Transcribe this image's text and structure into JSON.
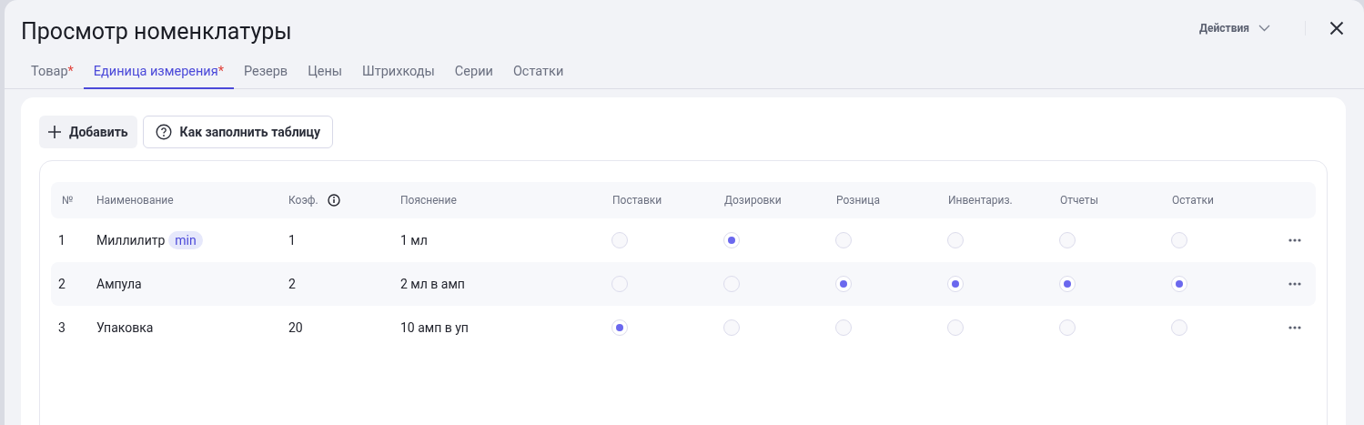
{
  "title": "Просмотр номенклатуры",
  "actions": {
    "label": "Действия"
  },
  "tabs": [
    {
      "label": "Товар",
      "mark": "*",
      "selected": false
    },
    {
      "label": "Единица измерения",
      "mark": "*",
      "selected": true
    },
    {
      "label": "Резерв",
      "selected": false
    },
    {
      "label": "Цены",
      "selected": false
    },
    {
      "label": "Штрихкоды",
      "selected": false
    },
    {
      "label": "Серии",
      "selected": false
    },
    {
      "label": "Остатки",
      "selected": false
    }
  ],
  "toolbar": {
    "add": "Добавить",
    "help": "Как заполнить таблицу"
  },
  "table": {
    "columns": [
      "№",
      "Наименование",
      "Коэф.",
      "Пояснение",
      "Поставки",
      "Дозировки",
      "Розница",
      "Инвентариз.",
      "Отчеты",
      "Остатки"
    ],
    "rows": [
      {
        "num": "1",
        "name": "Миллилитр",
        "badge": "min",
        "coef": "1",
        "note": "1 мл",
        "checks": [
          false,
          true,
          false,
          false,
          false,
          false
        ]
      },
      {
        "num": "2",
        "name": "Ампула",
        "coef": "2",
        "note": "2 мл в амп",
        "checks": [
          false,
          false,
          true,
          true,
          true,
          true
        ]
      },
      {
        "num": "3",
        "name": "Упаковка",
        "coef": "20",
        "note": "10 амп в уп",
        "checks": [
          true,
          false,
          false,
          false,
          false,
          false
        ]
      }
    ]
  }
}
